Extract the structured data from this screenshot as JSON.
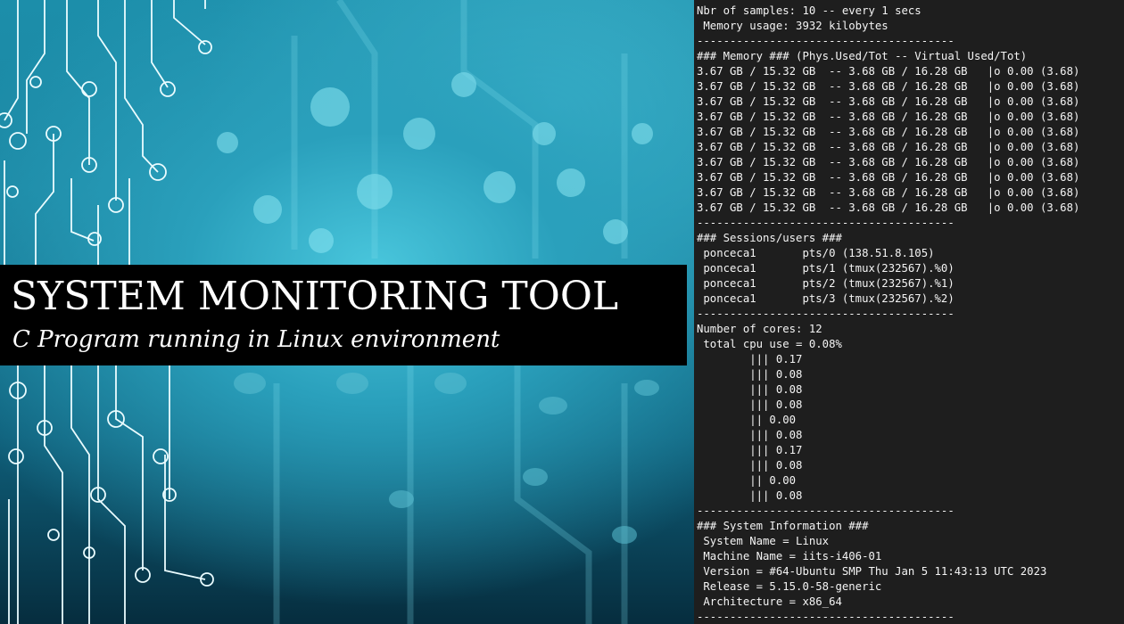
{
  "banner": {
    "title": "SYSTEM MONITORING TOOL",
    "subtitle": "C Program running in Linux environment"
  },
  "terminal": {
    "header": {
      "samples": "Nbr of samples: 10 -- every 1 secs",
      "memory_usage": " Memory usage: 3932 kilobytes"
    },
    "separator": "---------------------------------------",
    "memory": {
      "heading": "### Memory ### (Phys.Used/Tot -- Virtual Used/Tot)",
      "rows": [
        "3.67 GB / 15.32 GB  -- 3.68 GB / 16.28 GB   |o 0.00 (3.68)",
        "3.67 GB / 15.32 GB  -- 3.68 GB / 16.28 GB   |o 0.00 (3.68)",
        "3.67 GB / 15.32 GB  -- 3.68 GB / 16.28 GB   |o 0.00 (3.68)",
        "3.67 GB / 15.32 GB  -- 3.68 GB / 16.28 GB   |o 0.00 (3.68)",
        "3.67 GB / 15.32 GB  -- 3.68 GB / 16.28 GB   |o 0.00 (3.68)",
        "3.67 GB / 15.32 GB  -- 3.68 GB / 16.28 GB   |o 0.00 (3.68)",
        "3.67 GB / 15.32 GB  -- 3.68 GB / 16.28 GB   |o 0.00 (3.68)",
        "3.67 GB / 15.32 GB  -- 3.68 GB / 16.28 GB   |o 0.00 (3.68)",
        "3.67 GB / 15.32 GB  -- 3.68 GB / 16.28 GB   |o 0.00 (3.68)",
        "3.67 GB / 15.32 GB  -- 3.68 GB / 16.28 GB   |o 0.00 (3.68)"
      ]
    },
    "sessions": {
      "heading": "### Sessions/users ###",
      "rows": [
        " ponceca1       pts/0 (138.51.8.105)",
        " ponceca1       pts/1 (tmux(232567).%0)",
        " ponceca1       pts/2 (tmux(232567).%1)",
        " ponceca1       pts/3 (tmux(232567).%2)"
      ]
    },
    "cpu": {
      "cores": "Number of cores: 12",
      "total": " total cpu use = 0.08%",
      "bars": [
        "        ||| 0.17",
        "        ||| 0.08",
        "        ||| 0.08",
        "        ||| 0.08",
        "        || 0.00",
        "        ||| 0.08",
        "        ||| 0.17",
        "        ||| 0.08",
        "        || 0.00",
        "        ||| 0.08"
      ]
    },
    "system": {
      "heading": "### System Information ###",
      "rows": [
        " System Name = Linux",
        " Machine Name = iits-i406-01",
        " Version = #64-Ubuntu SMP Thu Jan 5 11:43:13 UTC 2023",
        " Release = 5.15.0-58-generic",
        " Architecture = x86_64"
      ]
    }
  }
}
